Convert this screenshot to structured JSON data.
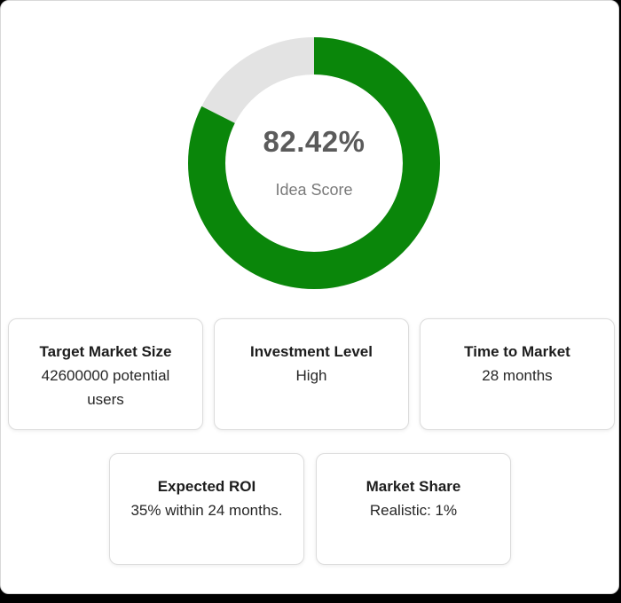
{
  "score": {
    "value_text": "82.42%",
    "fraction": 0.8242,
    "caption": "Idea Score",
    "fill_color": "#0a860a",
    "track_color": "#e3e3e3"
  },
  "metrics": [
    {
      "title": "Target Market Size",
      "value": "42600000 potential users"
    },
    {
      "title": "Investment Level",
      "value": "High"
    },
    {
      "title": "Time to Market",
      "value": "28 months"
    },
    {
      "title": "Expected ROI",
      "value": "35% within 24 months."
    },
    {
      "title": "Market Share",
      "value": "Realistic: 1%"
    }
  ]
}
